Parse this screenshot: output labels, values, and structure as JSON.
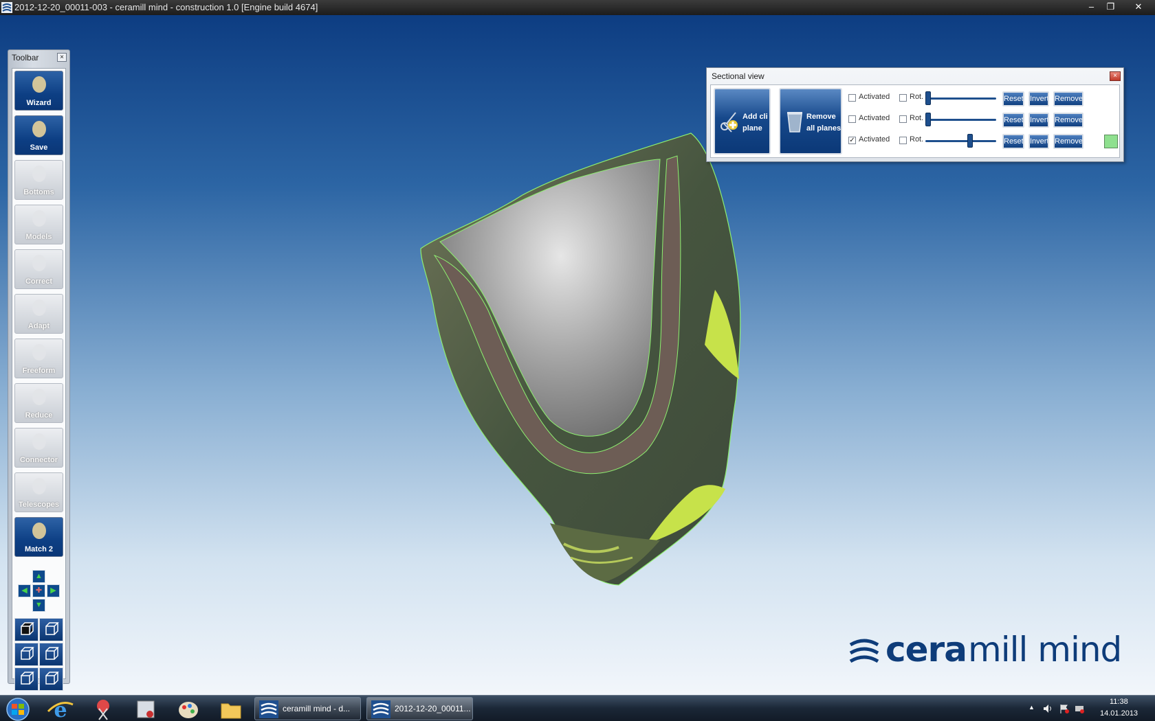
{
  "window": {
    "title": "2012-12-20_00011-003 - ceramill mind - construction 1.0 [Engine build 4674]",
    "controls": {
      "minimize": "–",
      "maximize": "❐",
      "close": "✕"
    }
  },
  "toolbar": {
    "title": "Toolbar",
    "close": "×",
    "tools": [
      {
        "label": "Wizard",
        "icon": "wizard-icon",
        "state": "active"
      },
      {
        "label": "Save",
        "icon": "save-icon",
        "state": "active"
      },
      {
        "label": "Bottoms",
        "icon": "bottoms-icon",
        "state": "inactive"
      },
      {
        "label": "Models",
        "icon": "models-icon",
        "state": "inactive"
      },
      {
        "label": "Correct",
        "icon": "correct-icon",
        "state": "inactive"
      },
      {
        "label": "Adapt",
        "icon": "adapt-icon",
        "state": "inactive"
      },
      {
        "label": "Freeform",
        "icon": "freeform-icon",
        "state": "inactive"
      },
      {
        "label": "Reduce",
        "icon": "reduce-icon",
        "state": "inactive"
      },
      {
        "label": "Connector",
        "icon": "connector-icon",
        "state": "inactive"
      },
      {
        "label": "Telescopes",
        "icon": "telescopes-icon",
        "state": "inactive"
      },
      {
        "label": "Match 2",
        "icon": "match-icon",
        "state": "active"
      }
    ],
    "nav_icons": [
      "arrow-up-icon",
      "arrow-left-icon",
      "center-icon",
      "arrow-right-icon",
      "arrow-down-icon"
    ],
    "view_icons": [
      "view-front-icon",
      "view-back-icon",
      "view-left-icon",
      "view-right-icon",
      "view-top-icon",
      "view-bottom-icon"
    ]
  },
  "sectional": {
    "title": "Sectional view",
    "close": "×",
    "add_plane": {
      "line1": "Add cli",
      "line2": "plane",
      "icon": "scissors-plus-icon"
    },
    "remove_all": {
      "line1": "Remove",
      "line2": "all planes",
      "icon": "trash-icon"
    },
    "rows": [
      {
        "activated_label": "Activated",
        "activated": false,
        "rot_label": "Rot.",
        "rot": false,
        "slider_fraction": 0.0,
        "reset": "Reset",
        "invert": "Invert",
        "remove": "Remove",
        "has_color": false
      },
      {
        "activated_label": "Activated",
        "activated": false,
        "rot_label": "Rot.",
        "rot": false,
        "slider_fraction": 0.0,
        "reset": "Reset",
        "invert": "Invert",
        "remove": "Remove",
        "has_color": false
      },
      {
        "activated_label": "Activated",
        "activated": true,
        "rot_label": "Rot.",
        "rot": false,
        "slider_fraction": 0.64,
        "reset": "Reset",
        "invert": "Invert",
        "remove": "Remove",
        "has_color": true,
        "color": "#8fe08f"
      }
    ]
  },
  "logo": {
    "part1": "cera",
    "part2": "mill mind"
  },
  "taskbar": {
    "pinned": [
      "windows-start-icon",
      "internet-explorer-icon",
      "snipping-tool-icon",
      "screen-capture-icon",
      "paint-icon",
      "folder-icon"
    ],
    "tasks": [
      {
        "label": "ceramill mind - d...",
        "icon": "ceramill-app-icon",
        "active": false
      },
      {
        "label": "2012-12-20_00011...",
        "icon": "ceramill-doc-icon",
        "active": true
      }
    ],
    "tray_icons": [
      "show-hidden-icons-icon",
      "volume-icon",
      "action-center-flag-icon",
      "network-icon"
    ],
    "time": "11:38",
    "date": "14.01.2013"
  }
}
